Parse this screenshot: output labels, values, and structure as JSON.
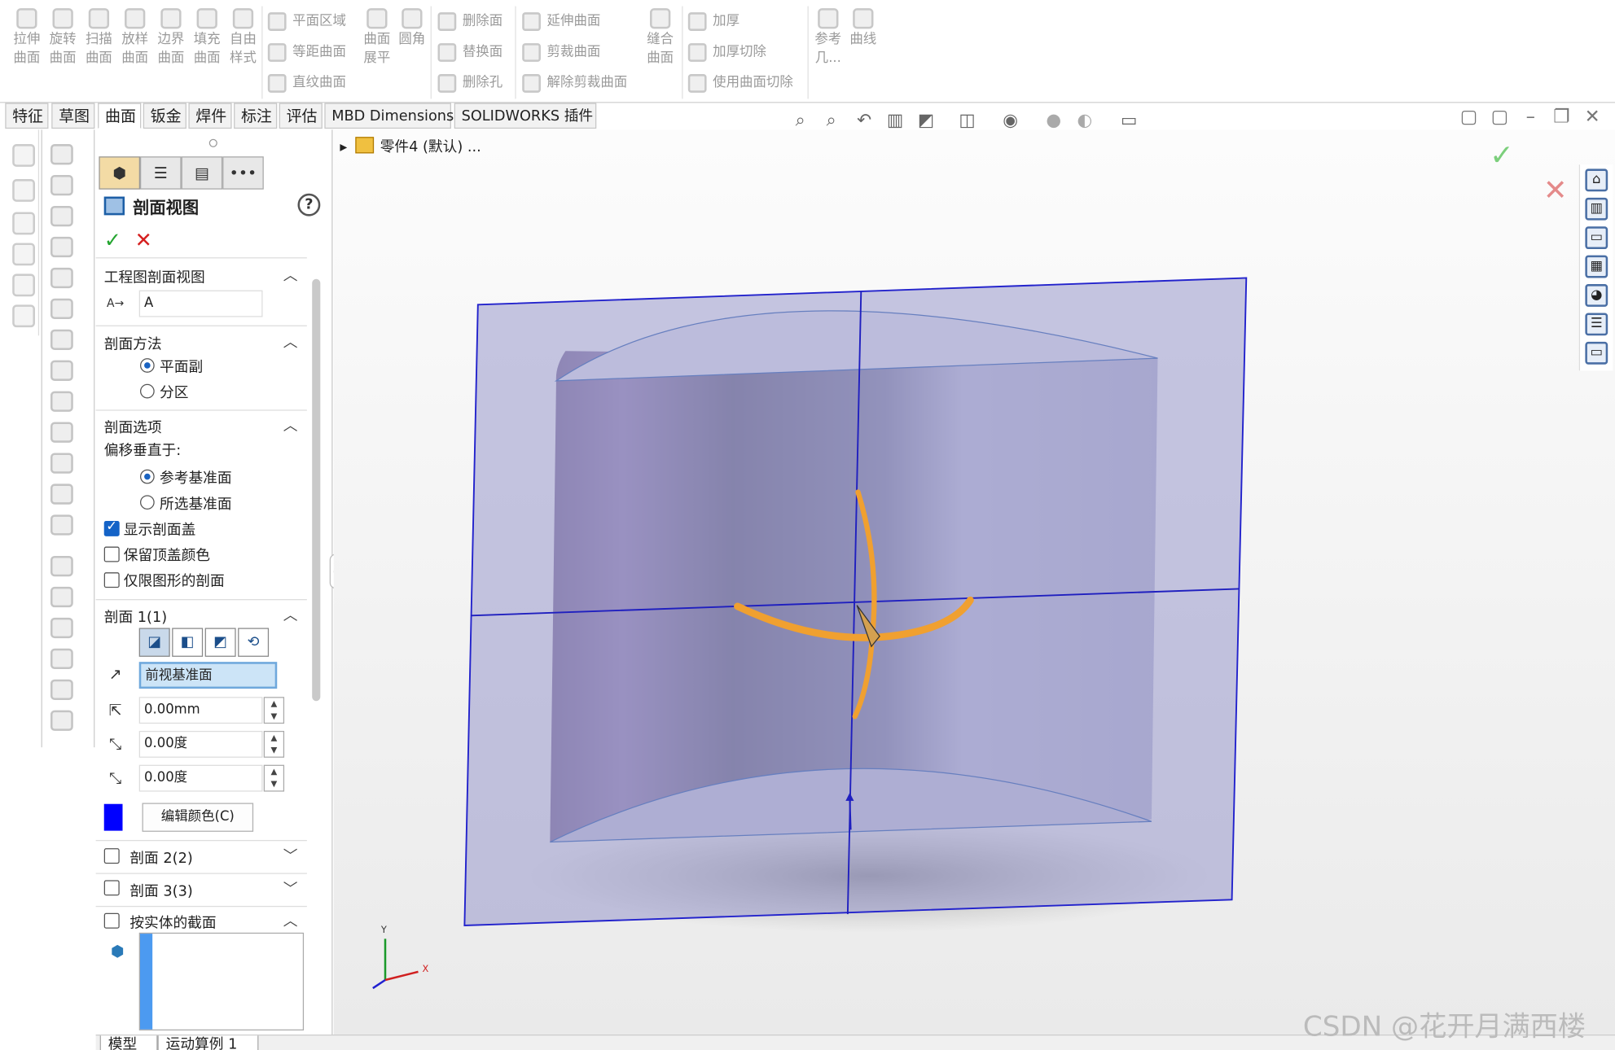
{
  "ribbon": {
    "row1": [
      [
        "拉伸",
        "曲面"
      ],
      [
        "旋转",
        "曲面"
      ],
      [
        "扫描",
        "曲面"
      ],
      [
        "放样",
        "曲面"
      ],
      [
        "边界",
        "曲面"
      ],
      [
        "填充",
        "曲面"
      ],
      [
        "自由",
        "样式"
      ]
    ],
    "small_col1": [
      "平面区域",
      "等距曲面",
      "直纹曲面"
    ],
    "col_mid": [
      [
        "曲面",
        "展平"
      ],
      [
        "圆角",
        ""
      ]
    ],
    "small_col2": [
      "删除面",
      "替换面",
      "删除孔"
    ],
    "small_col3": [
      "延伸曲面",
      "剪裁曲面",
      "解除剪裁曲面"
    ],
    "sew": [
      "缝合",
      "曲面"
    ],
    "small_col4": [
      "加厚",
      "加厚切除",
      "使用曲面切除"
    ],
    "ref": [
      "参考",
      "几..."
    ],
    "curve": [
      "曲线",
      ""
    ]
  },
  "tabs": [
    "特征",
    "草图",
    "曲面",
    "钣金",
    "焊件",
    "标注",
    "评估",
    "MBD Dimensions",
    "SOLIDWORKS 插件"
  ],
  "active_tab": "曲面",
  "tree": {
    "part": "零件4 (默认) ..."
  },
  "pm": {
    "title": "剖面视图",
    "help": "?",
    "ok": "✓",
    "cancel": "✕",
    "group_drawing": "工程图剖面视图",
    "drawing_name": "A",
    "group_method": "剖面方法",
    "method_options": [
      "平面副",
      "分区"
    ],
    "group_options": "剖面选项",
    "offset_label": "偏移垂直于:",
    "offset_options": [
      "参考基准面",
      "所选基准面"
    ],
    "show_cap": "显示剖面盖",
    "keep_color": "保留顶盖颜色",
    "graphics_only": "仅限图形的剖面",
    "section1": "剖面 1(1)",
    "plane": "前视基准面",
    "offset": "0.00mm",
    "angle_x": "0.00度",
    "angle_y": "0.00度",
    "edit_color": "编辑颜色(C)",
    "section2": "剖面 2(2)",
    "section3": "剖面 3(3)",
    "by_body": "按实体的截面",
    "section_color": "#0000ff"
  },
  "bottom_tabs": [
    "模型",
    "运动算例 1"
  ],
  "axis": {
    "x": "X",
    "y": "Y"
  },
  "watermark": "CSDN @花开月满西楼",
  "colors": {
    "plane": "#9999cc",
    "edge": "#2222cc",
    "handle": "#f0a030",
    "ok": "#24a530",
    "cancel": "#d51f1f"
  }
}
